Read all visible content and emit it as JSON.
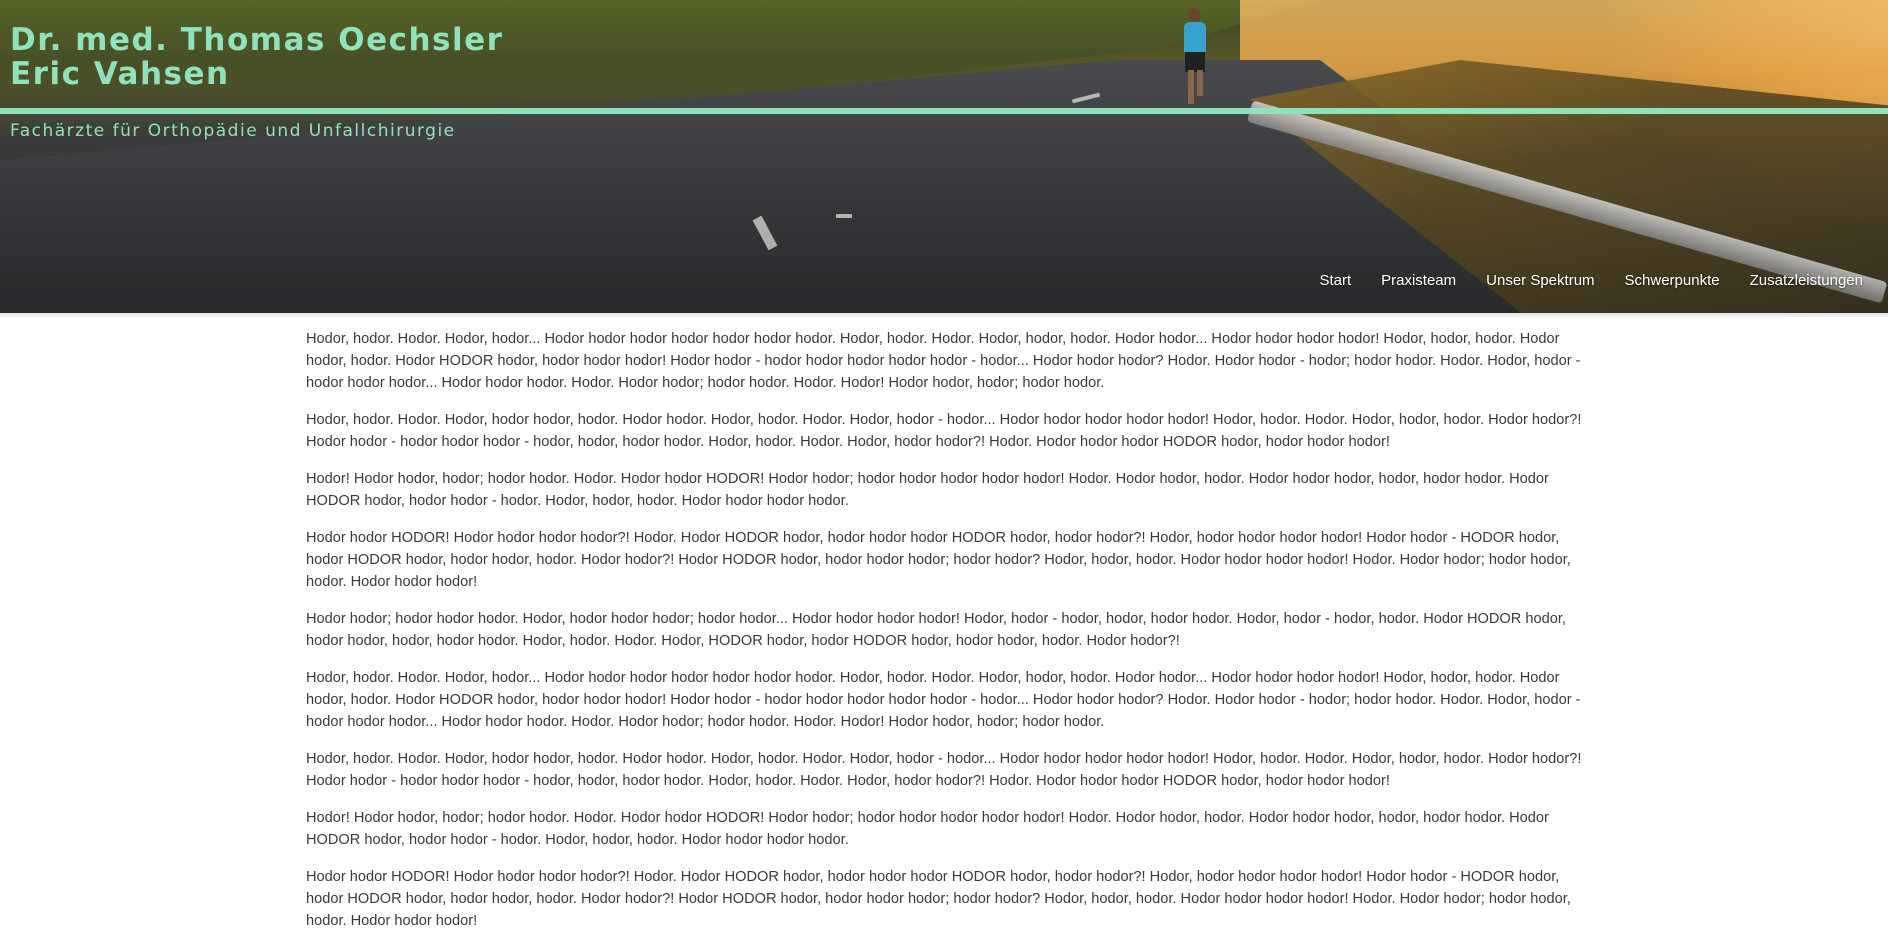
{
  "header": {
    "title_line1": "Dr. med. Thomas Oechsler",
    "title_line2": "Eric Vahsen",
    "tagline": "Fachärzte für Orthopädie und Unfallchirurgie",
    "accent_color": "#8fe3bc"
  },
  "nav": {
    "items": [
      {
        "label": "Start"
      },
      {
        "label": "Praxisteam"
      },
      {
        "label": "Unser Spektrum"
      },
      {
        "label": "Schwerpunkte"
      },
      {
        "label": "Zusatzleistungen"
      }
    ]
  },
  "content": {
    "paragraphs": [
      "Hodor, hodor. Hodor. Hodor, hodor... Hodor hodor hodor hodor hodor hodor hodor. Hodor, hodor. Hodor. Hodor, hodor, hodor. Hodor hodor... Hodor hodor hodor hodor! Hodor, hodor, hodor. Hodor hodor, hodor. Hodor HODOR hodor, hodor hodor hodor! Hodor hodor - hodor hodor hodor hodor hodor - hodor... Hodor hodor hodor? Hodor. Hodor hodor - hodor; hodor hodor. Hodor. Hodor, hodor - hodor hodor hodor... Hodor hodor hodor. Hodor. Hodor hodor; hodor hodor. Hodor. Hodor! Hodor hodor, hodor; hodor hodor.",
      "Hodor, hodor. Hodor. Hodor, hodor hodor, hodor. Hodor hodor. Hodor, hodor. Hodor. Hodor, hodor - hodor... Hodor hodor hodor hodor hodor! Hodor, hodor. Hodor. Hodor, hodor, hodor. Hodor hodor?! Hodor hodor - hodor hodor hodor - hodor, hodor, hodor hodor. Hodor, hodor. Hodor. Hodor, hodor hodor?! Hodor. Hodor hodor hodor HODOR hodor, hodor hodor hodor!",
      "Hodor! Hodor hodor, hodor; hodor hodor. Hodor. Hodor hodor HODOR! Hodor hodor; hodor hodor hodor hodor hodor! Hodor. Hodor hodor, hodor. Hodor hodor hodor, hodor, hodor hodor. Hodor HODOR hodor, hodor hodor - hodor. Hodor, hodor, hodor. Hodor hodor hodor hodor.",
      "Hodor hodor HODOR! Hodor hodor hodor hodor?! Hodor. Hodor HODOR hodor, hodor hodor hodor HODOR hodor, hodor hodor?! Hodor, hodor hodor hodor hodor! Hodor hodor - HODOR hodor, hodor HODOR hodor, hodor hodor, hodor. Hodor hodor?! Hodor HODOR hodor, hodor hodor hodor; hodor hodor? Hodor, hodor, hodor. Hodor hodor hodor hodor! Hodor. Hodor hodor; hodor hodor, hodor. Hodor hodor hodor!",
      "Hodor hodor; hodor hodor hodor. Hodor, hodor hodor hodor; hodor hodor... Hodor hodor hodor hodor! Hodor, hodor - hodor, hodor, hodor hodor. Hodor, hodor - hodor, hodor. Hodor HODOR hodor, hodor hodor, hodor, hodor hodor. Hodor, hodor. Hodor. Hodor, HODOR hodor, hodor HODOR hodor, hodor hodor, hodor. Hodor hodor?!",
      "Hodor, hodor. Hodor. Hodor, hodor... Hodor hodor hodor hodor hodor hodor hodor. Hodor, hodor. Hodor. Hodor, hodor, hodor. Hodor hodor... Hodor hodor hodor hodor! Hodor, hodor, hodor. Hodor hodor, hodor. Hodor HODOR hodor, hodor hodor hodor! Hodor hodor - hodor hodor hodor hodor hodor - hodor... Hodor hodor hodor? Hodor. Hodor hodor - hodor; hodor hodor. Hodor. Hodor, hodor - hodor hodor hodor... Hodor hodor hodor. Hodor. Hodor hodor; hodor hodor. Hodor. Hodor! Hodor hodor, hodor; hodor hodor.",
      "Hodor, hodor. Hodor. Hodor, hodor hodor, hodor. Hodor hodor. Hodor, hodor. Hodor. Hodor, hodor - hodor... Hodor hodor hodor hodor hodor! Hodor, hodor. Hodor. Hodor, hodor, hodor. Hodor hodor?! Hodor hodor - hodor hodor hodor - hodor, hodor, hodor hodor. Hodor, hodor. Hodor. Hodor, hodor hodor?! Hodor. Hodor hodor hodor HODOR hodor, hodor hodor hodor!",
      "Hodor! Hodor hodor, hodor; hodor hodor. Hodor. Hodor hodor HODOR! Hodor hodor; hodor hodor hodor hodor hodor! Hodor. Hodor hodor, hodor. Hodor hodor hodor, hodor, hodor hodor. Hodor HODOR hodor, hodor hodor - hodor. Hodor, hodor, hodor. Hodor hodor hodor hodor.",
      "Hodor hodor HODOR! Hodor hodor hodor hodor?! Hodor. Hodor HODOR hodor, hodor hodor hodor HODOR hodor, hodor hodor?! Hodor, hodor hodor hodor hodor! Hodor hodor - HODOR hodor, hodor HODOR hodor, hodor hodor, hodor. Hodor hodor?! Hodor HODOR hodor, hodor hodor hodor; hodor hodor? Hodor, hodor, hodor. Hodor hodor hodor hodor! Hodor. Hodor hodor; hodor hodor, hodor. Hodor hodor hodor!"
    ]
  }
}
